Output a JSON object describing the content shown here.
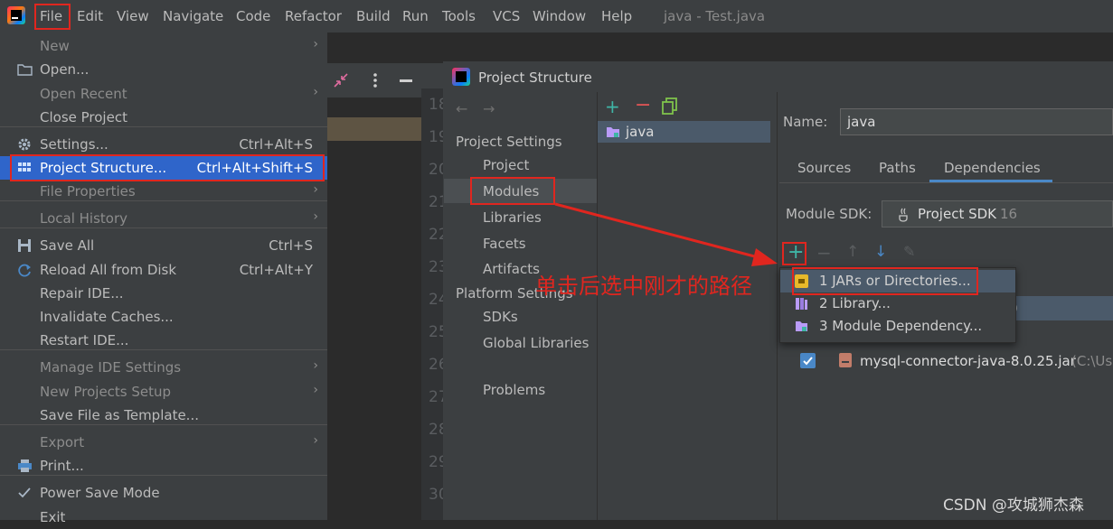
{
  "menubar": {
    "items": [
      "File",
      "Edit",
      "View",
      "Navigate",
      "Code",
      "Refactor",
      "Build",
      "Run",
      "Tools",
      "VCS",
      "Window",
      "Help"
    ],
    "title": "java - Test.java"
  },
  "file_menu": {
    "items": [
      {
        "label": "New",
        "shortcut": "",
        "submenu": true
      },
      {
        "label": "Open...",
        "shortcut": "",
        "submenu": false
      },
      {
        "label": "Open Recent",
        "shortcut": "",
        "submenu": true
      },
      {
        "label": "Close Project",
        "shortcut": "",
        "submenu": false
      },
      {
        "label": "Settings...",
        "shortcut": "Ctrl+Alt+S",
        "submenu": false
      },
      {
        "label": "Project Structure...",
        "shortcut": "Ctrl+Alt+Shift+S",
        "submenu": false
      },
      {
        "label": "File Properties",
        "shortcut": "",
        "submenu": true
      },
      {
        "label": "Local History",
        "shortcut": "",
        "submenu": true
      },
      {
        "label": "Save All",
        "shortcut": "Ctrl+S",
        "submenu": false
      },
      {
        "label": "Reload All from Disk",
        "shortcut": "Ctrl+Alt+Y",
        "submenu": false
      },
      {
        "label": "Repair IDE...",
        "shortcut": "",
        "submenu": false
      },
      {
        "label": "Invalidate Caches...",
        "shortcut": "",
        "submenu": false
      },
      {
        "label": "Restart IDE...",
        "shortcut": "",
        "submenu": false
      },
      {
        "label": "Manage IDE Settings",
        "shortcut": "",
        "submenu": true
      },
      {
        "label": "New Projects Setup",
        "shortcut": "",
        "submenu": true
      },
      {
        "label": "Save File as Template...",
        "shortcut": "",
        "submenu": false
      },
      {
        "label": "Export",
        "shortcut": "",
        "submenu": true
      },
      {
        "label": "Print...",
        "shortcut": "",
        "submenu": false
      },
      {
        "label": "Power Save Mode",
        "shortcut": "",
        "submenu": false
      },
      {
        "label": "Exit",
        "shortcut": "",
        "submenu": false
      }
    ]
  },
  "editor": {
    "line_numbers": [
      "18",
      "19",
      "20",
      "21",
      "22",
      "23",
      "24",
      "25",
      "26",
      "27",
      "28",
      "29",
      "30"
    ]
  },
  "dialog": {
    "title": "Project Structure",
    "project_settings_header": "Project Settings",
    "project_settings": [
      "Project",
      "Modules",
      "Libraries",
      "Facets",
      "Artifacts"
    ],
    "platform_settings_header": "Platform Settings",
    "platform_settings": [
      "SDKs",
      "Global Libraries"
    ],
    "problems": "Problems",
    "module_name": "java",
    "name_label": "Name:",
    "name_value": "java",
    "tabs": [
      "Sources",
      "Paths",
      "Dependencies"
    ],
    "active_tab": "Dependencies",
    "module_sdk_label": "Module SDK:",
    "module_sdk_value": "Project SDK",
    "module_sdk_version": "16",
    "dependency_row_partial": ")",
    "dependency_jar": "mysql-connector-java-8.0.25.jar",
    "dependency_path": "(C:\\Use"
  },
  "add_popup": {
    "items": [
      "1  JARs or Directories...",
      "2  Library...",
      "3  Module Dependency..."
    ]
  },
  "annotation_text": "单击后选中刚才的路径",
  "watermark": "CSDN @攻城狮杰森",
  "colors": {
    "highlight": "#2f65ca",
    "annotation_red": "#e0261f",
    "tab_underline": "#4a88c7",
    "add_green": "#3fb5a6"
  }
}
